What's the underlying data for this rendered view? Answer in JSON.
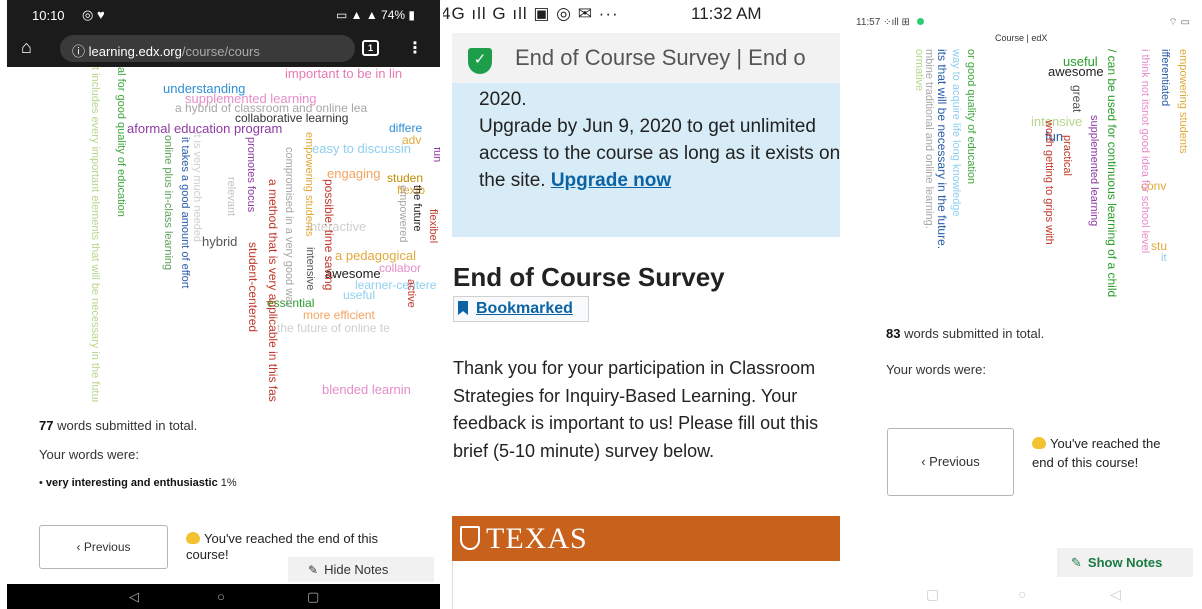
{
  "phone1": {
    "status": {
      "time": "10:10",
      "right": "74%"
    },
    "address": {
      "url_host": "learning.edx.org",
      "url_path": "/course/cours",
      "tabs_count": "1"
    },
    "cloud_words": [
      {
        "text": "important to be in lin",
        "color": "#e879b4"
      },
      {
        "text": "understanding",
        "color": "#2f8fd6"
      },
      {
        "text": "supplemented learning",
        "color": "#e58dc9"
      },
      {
        "text": "a hybrid of classroom and online lea",
        "color": "#a7a7a7"
      },
      {
        "text": "collaborative learning",
        "color": "#333333"
      },
      {
        "text": "aformal education program",
        "color": "#8e3aa4"
      },
      {
        "text": "differe",
        "color": "#2f8fd6"
      },
      {
        "text": "adv",
        "color": "#e0a93a"
      },
      {
        "text": "easy to discussin",
        "color": "#8ecff0"
      },
      {
        "text": "engaging",
        "color": "#f4a460"
      },
      {
        "text": "studen",
        "color": "#bf8c00"
      },
      {
        "text": "flexib",
        "color": "#e0a93a"
      },
      {
        "text": "interactive",
        "color": "#cfcfcf"
      },
      {
        "text": "hybrid",
        "color": "#555555"
      },
      {
        "text": "a pedagogical",
        "color": "#e0a93a"
      },
      {
        "text": "collabor",
        "color": "#e58dc9"
      },
      {
        "text": "awesome",
        "color": "#222222"
      },
      {
        "text": "learner-centere",
        "color": "#8ecff0"
      },
      {
        "text": "useful",
        "color": "#8ecff0"
      },
      {
        "text": "essential",
        "color": "#2a9d2a"
      },
      {
        "text": "more efficient",
        "color": "#f4a460"
      },
      {
        "text": "the future of online te",
        "color": "#cfcfcf"
      },
      {
        "text": "blended learnin",
        "color": "#e58dc9"
      },
      {
        "text": "al for good quality of education",
        "color": "#3ea83e"
      },
      {
        "text": "t includes every important elements that will be necessary in the future.",
        "color": "#b7d68c"
      },
      {
        "text": "it is very much needed",
        "color": "#cfcfcf"
      },
      {
        "text": "it takes a good amount of effort",
        "color": "#2a5da8"
      },
      {
        "text": "online plus in-class learning",
        "color": "#5aa05a"
      },
      {
        "text": "relevant",
        "color": "#c0c0c0"
      },
      {
        "text": "promotes focus",
        "color": "#8e3aa4"
      },
      {
        "text": "a method that is very applicable in this fast paced world.",
        "color": "#c0392b"
      },
      {
        "text": "student-centered",
        "color": "#c0392b"
      },
      {
        "text": "compromised in a very good way",
        "color": "#a7a7a7"
      },
      {
        "text": "empowering students",
        "color": "#e0a93a"
      },
      {
        "text": "possible: time saving",
        "color": "#c0392b"
      },
      {
        "text": "intensive",
        "color": "#555555"
      },
      {
        "text": "the future",
        "color": "#222222"
      },
      {
        "text": "empowered",
        "color": "#a7a7a7"
      },
      {
        "text": "flexibel",
        "color": "#c0392b"
      },
      {
        "text": "active",
        "color": "#c0392b"
      },
      {
        "text": "fun",
        "color": "#8e3aa4"
      }
    ],
    "words_count": "77",
    "words_submitted_text": " words submitted in total.",
    "your_words_label": "Your words were:",
    "submitted_entry": "very interesting and enthusiastic",
    "submitted_entry_pct": " 1%",
    "previous_label": "‹ Previous",
    "end_message": "You've reached the end of this course!",
    "hide_notes_label": "Hide Notes"
  },
  "phone2": {
    "status": {
      "left": "4G ıll  G ıll",
      "time": "11:32 AM"
    },
    "tab_title": "End of Course Survey | End o",
    "banner": {
      "line0": "2020.",
      "text": "Upgrade by Jun 9, 2020 to get unlimited access to the course as long as it exists on the site. ",
      "link": "Upgrade now"
    },
    "heading": "End of Course Survey",
    "bookmarked_label": "Bookmarked",
    "paragraph": "Thank you for your participation in Classroom Strategies for Inquiry-Based Learning. Your feedback is important to us! Please fill out this brief (5-10 minute) survey below.",
    "logo_text": "TEXAS"
  },
  "phone3": {
    "status": {
      "time": "11:57"
    },
    "course_label": "Course | edX",
    "cloud_words": [
      {
        "text": "useful",
        "color": "#2a9d2a"
      },
      {
        "text": "awesome",
        "color": "#222222"
      },
      {
        "text": "great",
        "color": "#555555"
      },
      {
        "text": "intensive",
        "color": "#b7d68c"
      },
      {
        "text": "fun",
        "color": "#2a5da8"
      },
      {
        "text": "conv",
        "color": "#e0a93a"
      },
      {
        "text": "stu",
        "color": "#e0a93a"
      },
      {
        "text": "it",
        "color": "#8ecff0"
      },
      {
        "text": "its that will be necessary in the future.",
        "color": "#2a5da8"
      },
      {
        "text": "mbine traditional and online learning.",
        "color": "#a7a7a7"
      },
      {
        "text": "ormative",
        "color": "#b7d68c"
      },
      {
        "text": "way to acquire life long knowledge",
        "color": "#8ecff0"
      },
      {
        "text": "or good quality of education",
        "color": "#3ea83e"
      },
      {
        "text": "worth getting to grips with",
        "color": "#c0392b"
      },
      {
        "text": "practical",
        "color": "#c0392b"
      },
      {
        "text": "supplemented learning",
        "color": "#8e3aa4"
      },
      {
        "text": "/ can be used for continuous learning of a child",
        "color": "#2a9d2a"
      },
      {
        "text": "i think not itsnot good idea for school level",
        "color": "#e58dc9"
      },
      {
        "text": "ifferentiated",
        "color": "#2a5da8"
      },
      {
        "text": "empowering students",
        "color": "#e0a93a"
      }
    ],
    "words_count": "83",
    "words_submitted_text": " words submitted in total.",
    "your_words_label": "Your words were:",
    "previous_label": "‹ Previous",
    "end_message": "You've reached the end of this course!",
    "show_notes_label": "Show Notes"
  }
}
